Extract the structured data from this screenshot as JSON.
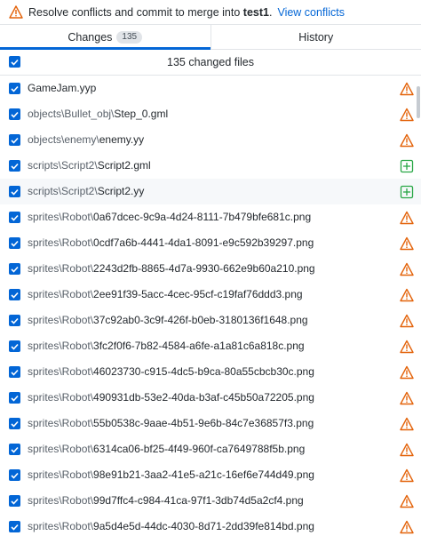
{
  "banner": {
    "icon": "warning-icon",
    "text": "Resolve conflicts and commit to merge into",
    "branch": "test1",
    "period": ".",
    "link": "View conflicts"
  },
  "tabs": [
    {
      "label": "Changes",
      "badge": "135",
      "active": true
    },
    {
      "label": "History",
      "active": false
    }
  ],
  "header": {
    "label": "135 changed files",
    "checked": true
  },
  "colors": {
    "accent": "#0366d6",
    "conflict": "#e36209",
    "added": "#28a745"
  },
  "files": [
    {
      "dir": "",
      "name": "GameJam.yyp",
      "status": "conflict"
    },
    {
      "dir": "objects\\Bullet_obj\\",
      "name": "Step_0.gml",
      "status": "conflict"
    },
    {
      "dir": "objects\\enemy\\",
      "name": "enemy.yy",
      "status": "conflict"
    },
    {
      "dir": "scripts\\Script2\\",
      "name": "Script2.gml",
      "status": "added"
    },
    {
      "dir": "scripts\\Script2\\",
      "name": "Script2.yy",
      "status": "added"
    },
    {
      "dir": "sprites\\Robot\\",
      "name": "0a67dcec-9c9a-4d24-8111-7b479bfe681c.png",
      "status": "conflict"
    },
    {
      "dir": "sprites\\Robot\\",
      "name": "0cdf7a6b-4441-4da1-8091-e9c592b39297.png",
      "status": "conflict"
    },
    {
      "dir": "sprites\\Robot\\",
      "name": "2243d2fb-8865-4d7a-9930-662e9b60a210.png",
      "status": "conflict"
    },
    {
      "dir": "sprites\\Robot\\",
      "name": "2ee91f39-5acc-4cec-95cf-c19faf76ddd3.png",
      "status": "conflict"
    },
    {
      "dir": "sprites\\Robot\\",
      "name": "37c92ab0-3c9f-426f-b0eb-3180136f1648.png",
      "status": "conflict"
    },
    {
      "dir": "sprites\\Robot\\",
      "name": "3fc2f0f6-7b82-4584-a6fe-a1a81c6a818c.png",
      "status": "conflict"
    },
    {
      "dir": "sprites\\Robot\\",
      "name": "46023730-c915-4dc5-b9ca-80a55cbcb30c.png",
      "status": "conflict"
    },
    {
      "dir": "sprites\\Robot\\",
      "name": "490931db-53e2-40da-b3af-c45b50a72205.png",
      "status": "conflict"
    },
    {
      "dir": "sprites\\Robot\\",
      "name": "55b0538c-9aae-4b51-9e6b-84c7e36857f3.png",
      "status": "conflict"
    },
    {
      "dir": "sprites\\Robot\\",
      "name": "6314ca06-bf25-4f49-960f-ca7649788f5b.png",
      "status": "conflict"
    },
    {
      "dir": "sprites\\Robot\\",
      "name": "98e91b21-3aa2-41e5-a21c-16ef6e744d49.png",
      "status": "conflict"
    },
    {
      "dir": "sprites\\Robot\\",
      "name": "99d7ffc4-c984-41ca-97f1-3db74d5a2cf4.png",
      "status": "conflict"
    },
    {
      "dir": "sprites\\Robot\\",
      "name": "9a5d4e5d-44dc-4030-8d71-2dd39fe814bd.png",
      "status": "conflict"
    }
  ]
}
